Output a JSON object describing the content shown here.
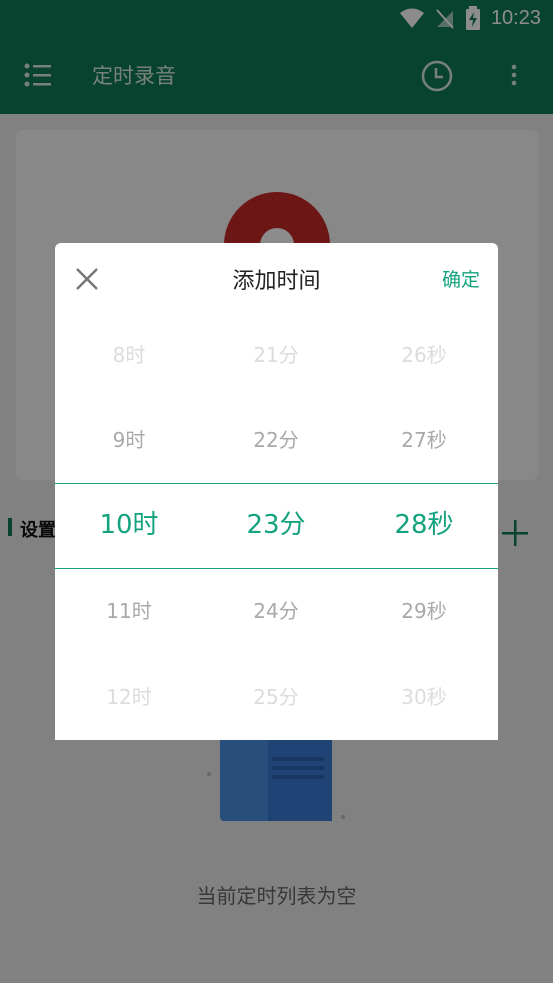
{
  "status": {
    "time": "10:23"
  },
  "appbar": {
    "title": "定时录音",
    "icons": {
      "menu": "list-menu-icon",
      "clock": "clock-icon",
      "more": "more-vert-icon"
    }
  },
  "background": {
    "settings_label": "设置",
    "empty_text": "当前定时列表为空"
  },
  "dialog": {
    "title": "添加时间",
    "confirm_label": "确定",
    "columns": {
      "hour": [
        "8时",
        "9时",
        "10时",
        "11时",
        "12时"
      ],
      "minute": [
        "21分",
        "22分",
        "23分",
        "24分",
        "25分"
      ],
      "second": [
        "26秒",
        "27秒",
        "28秒",
        "29秒",
        "30秒"
      ]
    },
    "selected": {
      "hour": "10时",
      "minute": "23分",
      "second": "28秒"
    }
  },
  "colors": {
    "accent": "#14a37f",
    "appbar": "#0f7a58",
    "record": "#c62828"
  }
}
